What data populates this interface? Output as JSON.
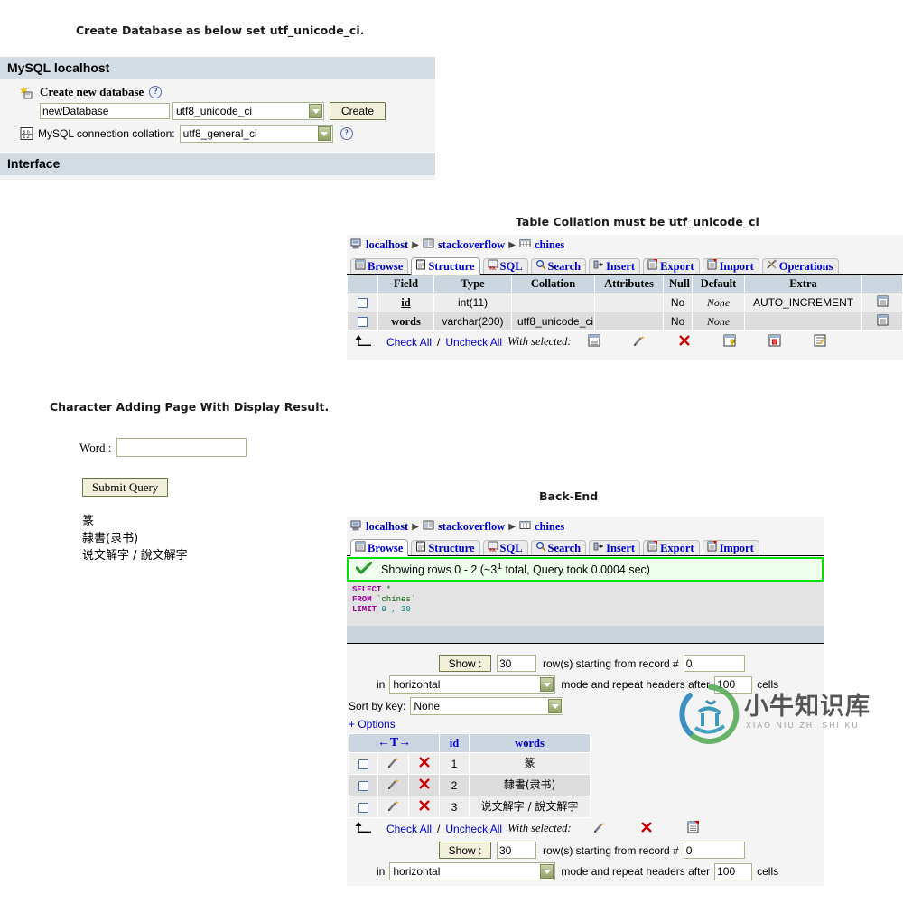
{
  "captions": {
    "create_db": "Create Database as below set utf_unicode_ci.",
    "table_collation": "Table Collation must be utf_unicode_ci",
    "char_page": "Character Adding Page With Display Result.",
    "back_end": "Back-End"
  },
  "server_panel": {
    "header": "MySQL localhost",
    "create_db_label": "Create new database",
    "help_icon": "help-icon",
    "db_name_value": "newDatabase",
    "db_collation_value": "utf8_unicode_ci",
    "create_button": "Create",
    "connection_collation_label": "MySQL connection collation:",
    "connection_collation_value": "utf8_general_ci",
    "interface_header": "Interface"
  },
  "structure_panel": {
    "breadcrumb": [
      {
        "icon": "server-icon",
        "label": "localhost"
      },
      {
        "icon": "database-icon",
        "label": "stackoverflow"
      },
      {
        "icon": "table-icon",
        "label": "chines"
      }
    ],
    "tabs": [
      {
        "label": "Browse",
        "icon": "browse-icon",
        "active": false
      },
      {
        "label": "Structure",
        "icon": "structure-icon",
        "active": true
      },
      {
        "label": "SQL",
        "icon": "sql-icon",
        "active": false
      },
      {
        "label": "Search",
        "icon": "search-icon",
        "active": false
      },
      {
        "label": "Insert",
        "icon": "insert-icon",
        "active": false
      },
      {
        "label": "Export",
        "icon": "export-icon",
        "active": false
      },
      {
        "label": "Import",
        "icon": "import-icon",
        "active": false
      },
      {
        "label": "Operations",
        "icon": "operations-icon",
        "active": false
      }
    ],
    "columns": [
      "",
      "Field",
      "Type",
      "Collation",
      "Attributes",
      "Null",
      "Default",
      "Extra",
      ""
    ],
    "rows": [
      {
        "field": "id",
        "type": "int(11)",
        "collation": "",
        "attributes": "",
        "null": "No",
        "default": "None",
        "extra": "AUTO_INCREMENT"
      },
      {
        "field": "words",
        "type": "varchar(200)",
        "collation": "utf8_unicode_ci",
        "attributes": "",
        "null": "No",
        "default": "None",
        "extra": ""
      }
    ],
    "footer": {
      "check_all": "Check All",
      "separator": "/",
      "uncheck_all": "Uncheck All",
      "with_selected": "With selected:",
      "action_icons": [
        "browse-icon",
        "pencil-icon",
        "drop-icon",
        "primary-key-icon",
        "unique-icon",
        "index-icon"
      ]
    }
  },
  "word_form": {
    "label": "Word :",
    "input_value": "",
    "submit_label": "Submit Query",
    "results": [
      "篆",
      "隸書(隶书)",
      "说文解字 / 說文解字"
    ]
  },
  "backend_panel": {
    "breadcrumb": [
      {
        "icon": "server-icon",
        "label": "localhost"
      },
      {
        "icon": "database-icon",
        "label": "stackoverflow"
      },
      {
        "icon": "table-icon",
        "label": "chines"
      }
    ],
    "tabs": [
      {
        "label": "Browse",
        "icon": "browse-icon",
        "active": true
      },
      {
        "label": "Structure",
        "icon": "structure-icon",
        "active": false
      },
      {
        "label": "SQL",
        "icon": "sql-icon",
        "active": false
      },
      {
        "label": "Search",
        "icon": "search-icon",
        "active": false
      },
      {
        "label": "Insert",
        "icon": "insert-icon",
        "active": false
      },
      {
        "label": "Export",
        "icon": "export-icon",
        "active": false
      },
      {
        "label": "Import",
        "icon": "import-icon",
        "active": false
      }
    ],
    "status_text": "Showing rows 0 - 2 (~3",
    "status_sup": "1",
    "status_text2": " total, Query took 0.0004 sec)",
    "sql_lines": [
      {
        "kw": "SELECT",
        "rest": " *"
      },
      {
        "kw": "FROM",
        "rest": " `chines`"
      },
      {
        "kw": "LIMIT",
        "rest": " 0 , 30"
      }
    ],
    "controls_top": {
      "show_button": "Show :",
      "rows_value": "30",
      "rows_text": "row(s) starting from record #",
      "record_value": "0",
      "in_label": "in",
      "mode_value": "horizontal",
      "mode_text": "mode and repeat headers after",
      "headers_value": "100",
      "cells_text": "cells",
      "sort_label": "Sort by key:",
      "sort_value": "None",
      "options_label": "+ Options"
    },
    "grid_columns": [
      "id",
      "words"
    ],
    "grid_rows": [
      {
        "id": "1",
        "words": "篆"
      },
      {
        "id": "2",
        "words": "隸書(隶书)"
      },
      {
        "id": "3",
        "words": "说文解字 / 說文解字"
      }
    ],
    "grid_footer": {
      "check_all": "Check All",
      "separator": "/",
      "uncheck_all": "Uncheck All",
      "with_selected": "With selected:",
      "action_icons": [
        "pencil-icon",
        "drop-icon",
        "export-icon"
      ]
    },
    "controls_bottom": {
      "show_button": "Show :",
      "rows_value": "30",
      "rows_text": "row(s) starting from record #",
      "record_value": "0",
      "in_label": "in",
      "mode_value": "horizontal",
      "mode_text": "mode and repeat headers after",
      "headers_value": "100",
      "cells_text": "cells"
    }
  },
  "watermark": {
    "cn": "小牛知识库",
    "en": "XIAO NIU ZHI SHI KU"
  },
  "colors": {
    "panel_header": "#d3dce3",
    "tab_link": "#0000cc",
    "ok_border": "#00dd00",
    "input_border": "#a9b48c"
  }
}
